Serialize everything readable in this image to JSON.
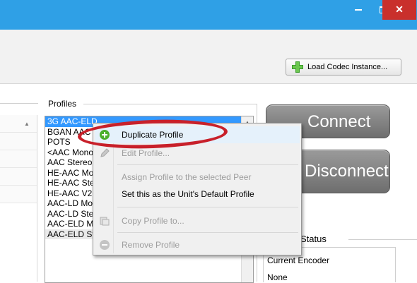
{
  "window": {
    "controls": {
      "minimize": "",
      "maximize": "",
      "close": "✕"
    }
  },
  "toolbar": {
    "load_codec_label": "Load Codec Instance..."
  },
  "profiles": {
    "group_label": "Profiles",
    "items": [
      "3G AAC-ELD",
      "BGAN AAC",
      "POTS",
      "<AAC Mono",
      "AAC Stereo",
      "HE-AAC Mono",
      "HE-AAC Stereo",
      "HE-AAC V2",
      "AAC-LD Mono",
      "AAC-LD Stereo",
      "AAC-ELD Mono",
      "AAC-ELD Stereo"
    ],
    "selected_index": 0
  },
  "buttons": {
    "connect": "Connect",
    "disconnect": "Disconnect"
  },
  "status": {
    "group_label": "Status",
    "encoder_label": "Current Encoder",
    "encoder_value": "None"
  },
  "context_menu": {
    "items": [
      {
        "label": "Duplicate Profile",
        "icon": "add-green-icon",
        "enabled": true
      },
      {
        "label": "Edit Profile...",
        "icon": "edit-icon",
        "enabled": false
      },
      {
        "label": "Assign Profile to the selected Peer",
        "icon": "",
        "enabled": false
      },
      {
        "label": "Set this as the Unit's Default Profile",
        "icon": "",
        "enabled": true
      },
      {
        "label": "Copy Profile to...",
        "icon": "copy-icon",
        "enabled": false
      },
      {
        "label": "Remove Profile",
        "icon": "remove-icon",
        "enabled": false
      }
    ]
  },
  "colors": {
    "title_bar": "#2fa0e6",
    "close_button": "#c9302c",
    "selection": "#3399ff",
    "annotation": "#c8202a",
    "button_gray": "#7f7f7f"
  }
}
